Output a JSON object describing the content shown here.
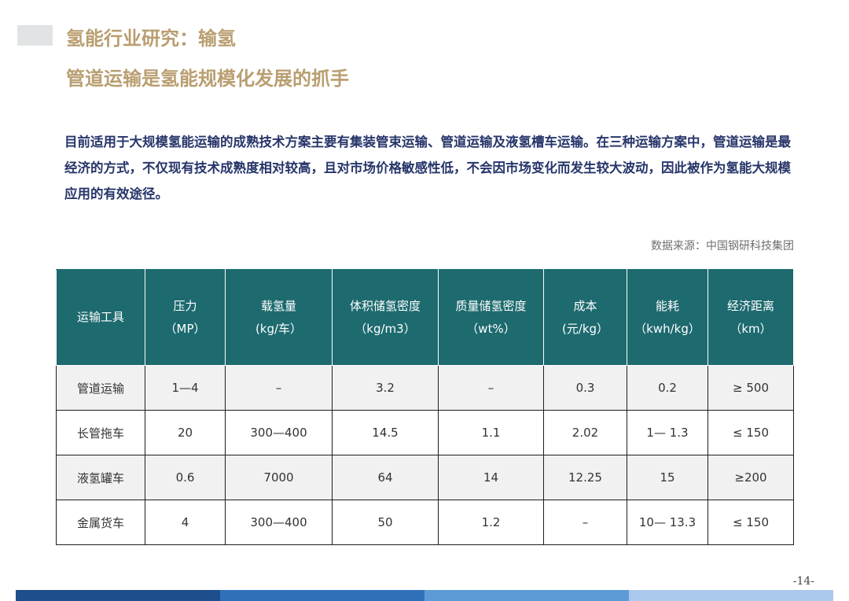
{
  "header": {
    "title": "氢能行业研究：输氢",
    "subtitle": "管道运输是氢能规模化发展的抓手"
  },
  "paragraph": "目前适用于大规模氢能运输的成熟技术方案主要有集装管束运输、管道运输及液氢槽车运输。在三种运输方案中，管道运输是最经济的方式，不仅现有技术成熟度相对较高，且对市场价格敏感性低，不会因市场变化而发生较大波动，因此被作为氢能大规模应用的有效途径。",
  "source": "数据来源：中国钢研科技集团",
  "table": {
    "headers": [
      {
        "line1": "运输工具",
        "line2": ""
      },
      {
        "line1": "压力",
        "line2": "（MP）"
      },
      {
        "line1": "载氢量",
        "line2": "(kg/车）"
      },
      {
        "line1": "体积储氢密度",
        "line2": "（kg/m3）"
      },
      {
        "line1": "质量储氢密度",
        "line2": "（wt%）"
      },
      {
        "line1": "成本",
        "line2": "(元/kg）"
      },
      {
        "line1": "能耗",
        "line2": "（kwh/kg）"
      },
      {
        "line1": "经济距离",
        "line2": "（km）"
      }
    ],
    "rows": [
      [
        "管道运输",
        "1—4",
        "–",
        "3.2",
        "–",
        "0.3",
        "0.2",
        "≥ 500"
      ],
      [
        "长管拖车",
        "20",
        "300—400",
        "14.5",
        "1.1",
        "2.02",
        "1— 1.3",
        "≤ 150"
      ],
      [
        "液氢罐车",
        "0.6",
        "7000",
        "64",
        "14",
        "12.25",
        "15",
        "≥200"
      ],
      [
        "金属货车",
        "4",
        "300—400",
        "50",
        "1.2",
        "–",
        "10— 13.3",
        "≤ 150"
      ]
    ]
  },
  "page_number": "-14-",
  "colors": {
    "title": "#b99e70",
    "paragraph": "#27366a",
    "table_header_bg": "#1d6a6f",
    "footer": [
      "#1f4e8c",
      "#3070b8",
      "#5d9bd7",
      "#a9c8ec"
    ]
  }
}
